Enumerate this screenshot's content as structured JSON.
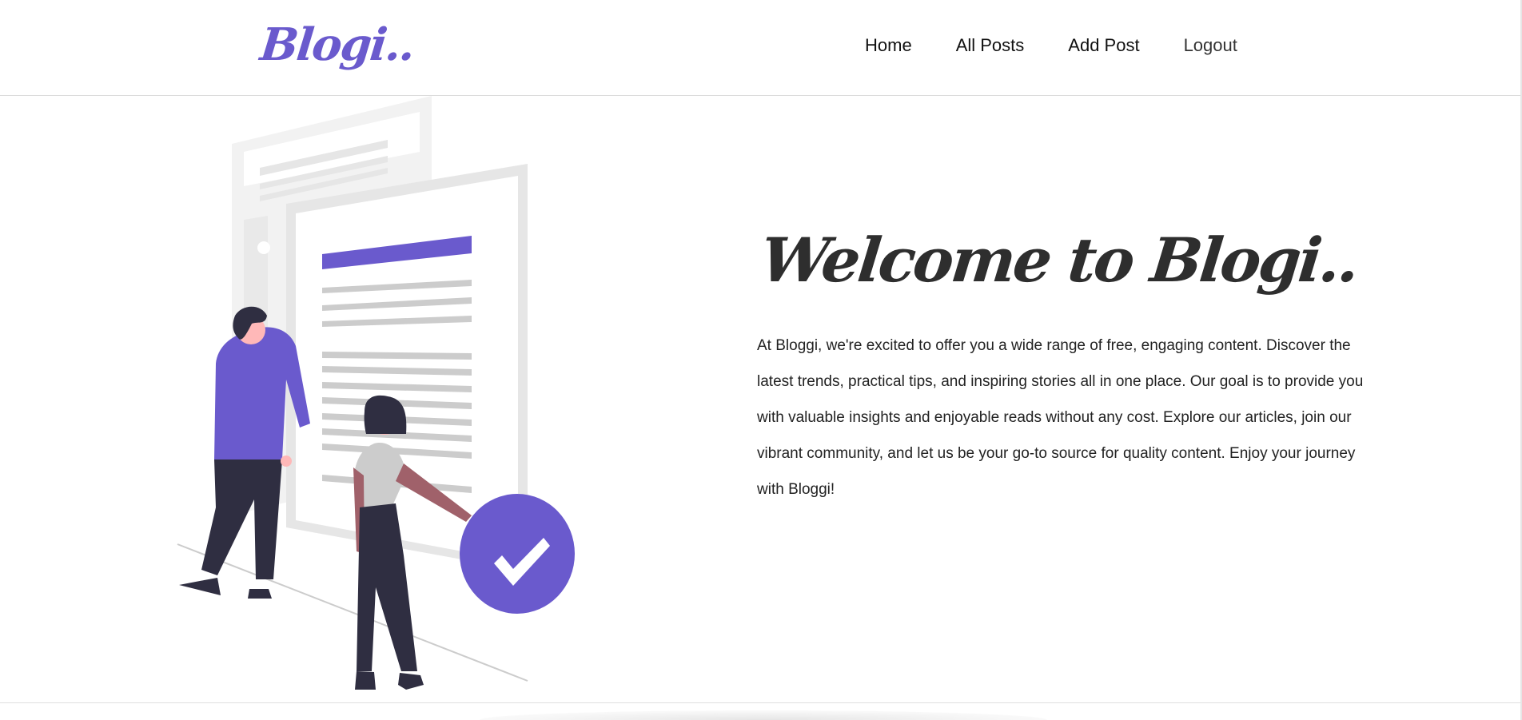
{
  "brand": {
    "logo_text": "Blogi.."
  },
  "nav": {
    "items": [
      {
        "label": "Home"
      },
      {
        "label": "All Posts"
      },
      {
        "label": "Add Post"
      },
      {
        "label": "Logout"
      }
    ]
  },
  "hero": {
    "title": "Welcome to Blogi..",
    "description": "At Bloggi, we're excited to offer you a wide range of free, engaging content. Discover the latest trends, practical tips, and inspiring stories all in one place. Our goal is to provide you with valuable insights and enjoyable reads without any cost. Explore our articles, join our vibrant community, and let us be your go-to source for quality content. Enjoy your journey with Bloggi!",
    "illustration_icon": "people-document-checkmark-illustration"
  },
  "colors": {
    "accent": "#6a5acd",
    "text_dark": "#2e2e2e",
    "figure_dark": "#2f2e41",
    "skin_dark": "#a0616a",
    "skin_light": "#ffb8b8",
    "doc_gray": "#e6e6e6",
    "line_gray": "#cccccc"
  }
}
